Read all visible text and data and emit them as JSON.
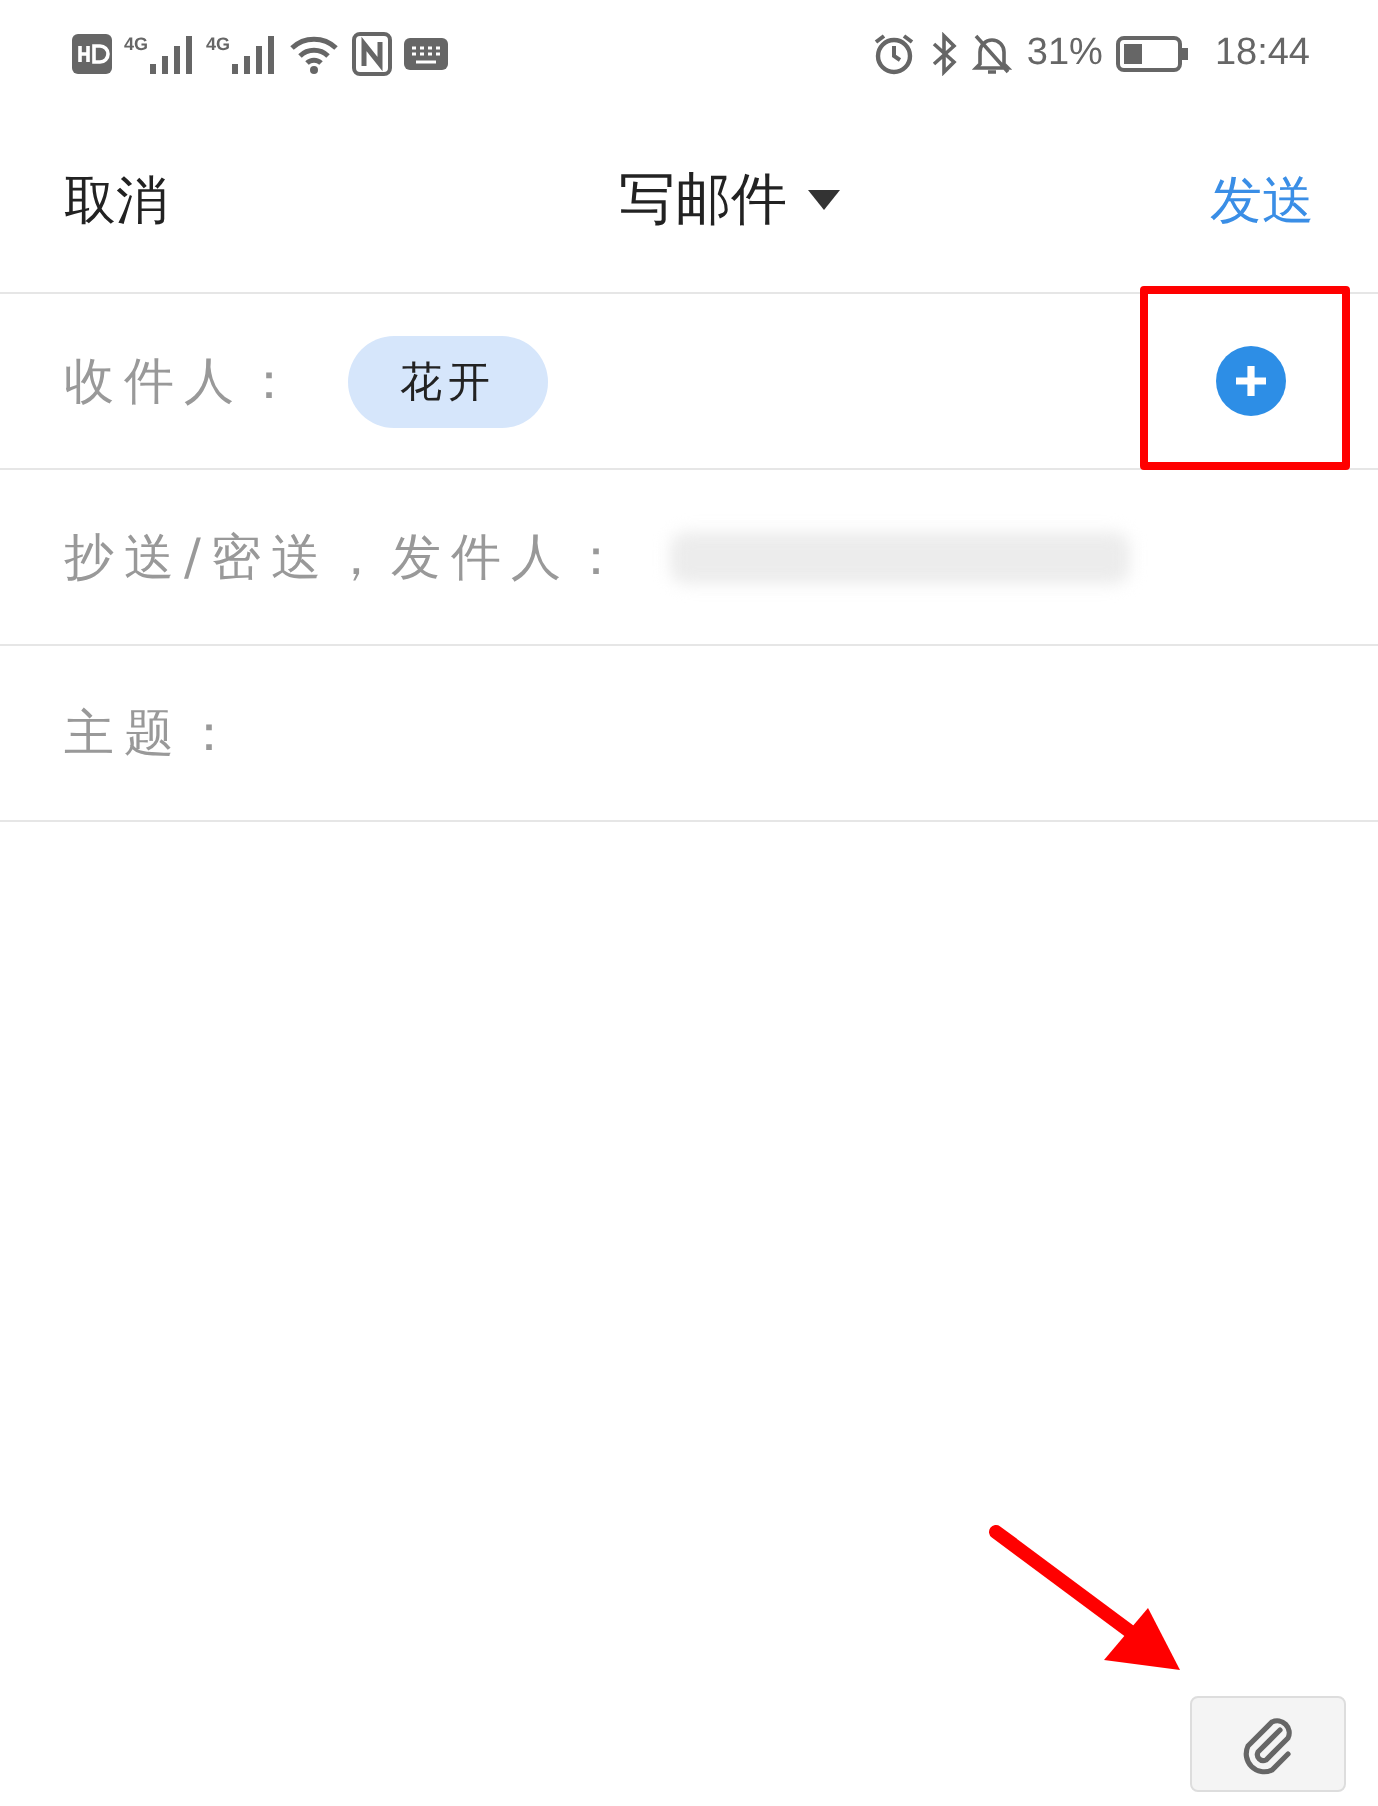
{
  "status_bar": {
    "network_labels": [
      "4G",
      "4G"
    ],
    "battery": "31%",
    "time": "18:44"
  },
  "header": {
    "cancel": "取消",
    "title": "写邮件",
    "send": "发送"
  },
  "fields": [
    {
      "kind": "recipients",
      "label": "收件人：",
      "chips": [
        "花开"
      ]
    },
    {
      "kind": "redacted",
      "label": "抄送/密送，发件人："
    },
    {
      "kind": "plain",
      "label": "主题："
    }
  ]
}
